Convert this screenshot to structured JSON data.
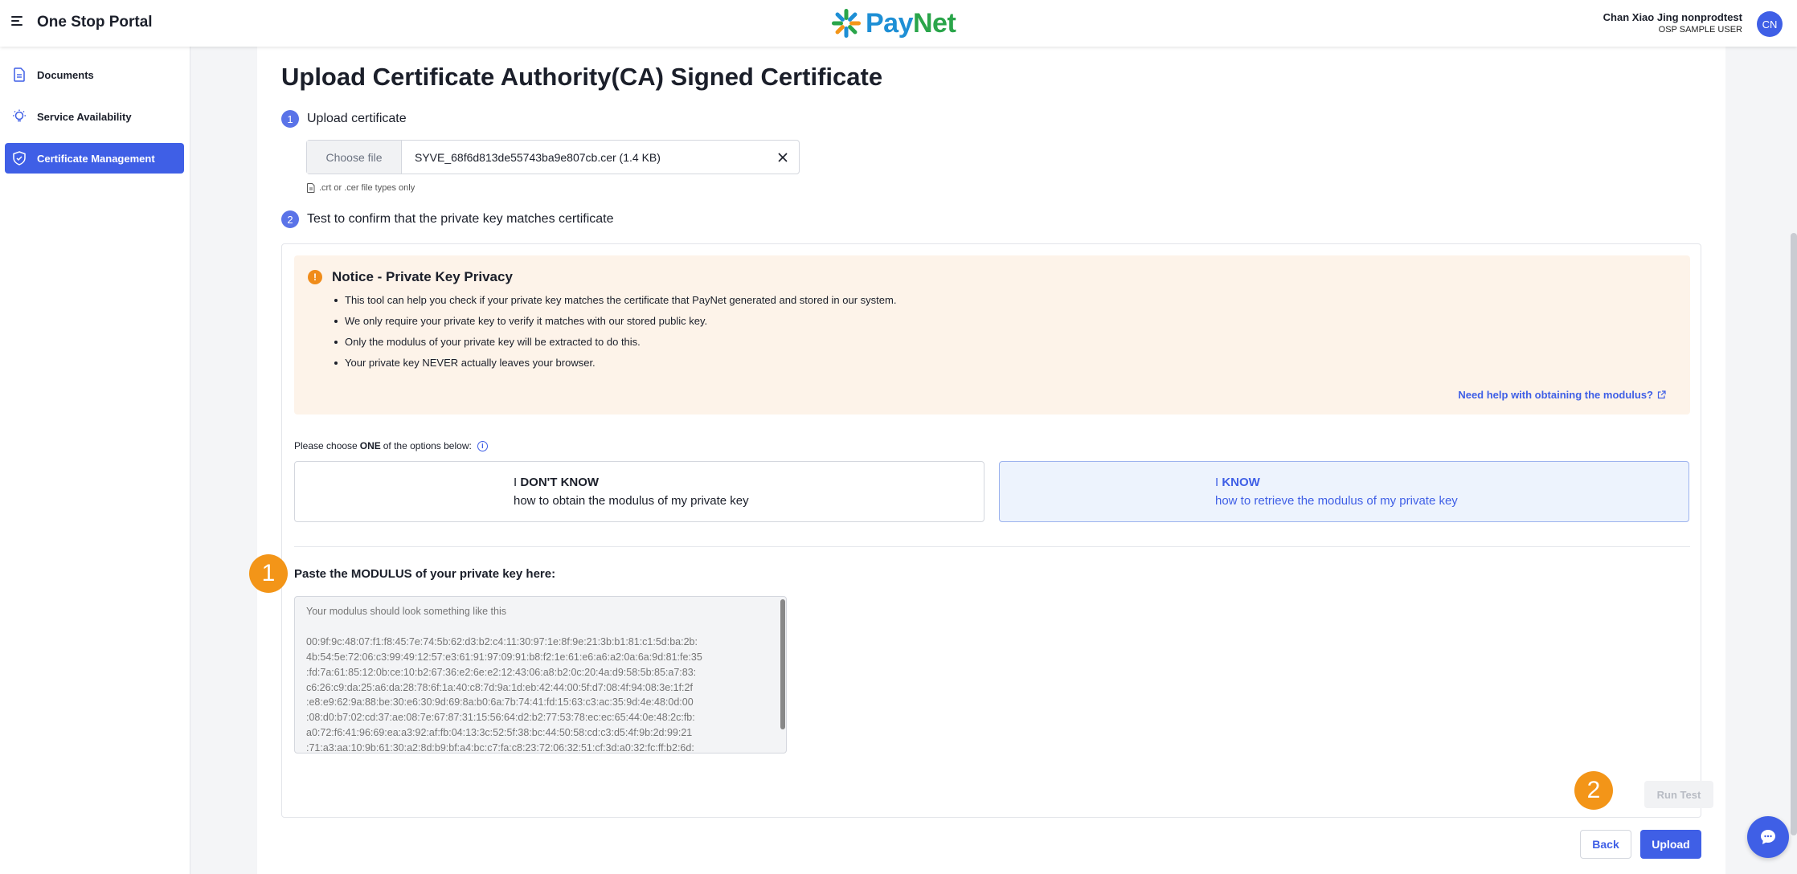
{
  "header": {
    "app_title": "One Stop Portal",
    "logo_text_pay": "Pay",
    "logo_text_net": "Net",
    "user_name": "Chan Xiao Jing nonprodtest",
    "user_role": "OSP SAMPLE USER",
    "avatar_initials": "CN"
  },
  "sidebar": {
    "items": [
      {
        "label": "Documents",
        "icon": "document-icon",
        "active": false
      },
      {
        "label": "Service Availability",
        "icon": "lightbulb-icon",
        "active": false
      },
      {
        "label": "Certificate Management",
        "icon": "shield-check-icon",
        "active": true
      }
    ]
  },
  "main": {
    "title": "Upload Certificate Authority(CA) Signed Certificate",
    "step1": {
      "number": "1",
      "label": "Upload certificate"
    },
    "file": {
      "choose_label": "Choose file",
      "file_name": "SYVE_68f6d813de55743ba9e807cb.cer (1.4 KB)",
      "hint": ".crt or .cer file types only"
    },
    "step2": {
      "number": "2",
      "label": "Test to confirm that the private key matches certificate"
    },
    "notice": {
      "title": "Notice - Private Key Privacy",
      "items": [
        "This tool can help you check if your private key matches the certificate that PayNet generated and stored in our system.",
        "We only require your private key to verify it matches with our stored public key.",
        "Only the modulus of your private key will be extracted to do this.",
        "Your private key NEVER actually leaves your browser."
      ],
      "help_link": "Need help with obtaining the modulus?"
    },
    "choose": {
      "prefix": "Please choose",
      "emphasis": "ONE",
      "suffix": "of the options below:"
    },
    "options": [
      {
        "prefix": "I",
        "bold": "DON'T KNOW",
        "subtitle": "how to obtain the modulus of my private key",
        "selected": false
      },
      {
        "prefix": "I",
        "bold": "KNOW",
        "subtitle": "how to retrieve the modulus of my private key",
        "selected": true
      }
    ],
    "modulus_label": "Paste the MODULUS of your private key here:",
    "modulus_placeholder": "Your modulus should look something like this\n\n00:9f:9c:48:07:f1:f8:45:7e:74:5b:62:d3:b2:c4:11:30:97:1e:8f:9e:21:3b:b1:81:c1:5d:ba:2b:\n4b:54:5e:72:06:c3:99:49:12:57:e3:61:91:97:09:91:b8:f2:1e:61:e6:a6:a2:0a:6a:9d:81:fe:35\n:fd:7a:61:85:12:0b:ce:10:b2:67:36:e2:6e:e2:12:43:06:a8:b2:0c:20:4a:d9:58:5b:85:a7:83:\nc6:26:c9:da:25:a6:da:28:78:6f:1a:40:c8:7d:9a:1d:eb:42:44:00:5f:d7:08:4f:94:08:3e:1f:2f\n:e8:e9:62:9a:88:be:30:e6:30:9d:69:8a:b0:6a:7b:74:41:fd:15:63:c3:ac:35:9d:4e:48:0d:00\n:08:d0:b7:02:cd:37:ae:08:7e:67:87:31:15:56:64:d2:b2:77:53:78:ec:ec:65:44:0e:48:2c:fb:\na0:72:f6:41:96:69:ea:a3:92:af:fb:04:13:3c:52:5f:38:bc:44:50:58:cd:c3:d5:4f:9b:2d:99:21\n:71:a3:aa:10:9b:61:30:a2:8d:b9:bf:a4:bc:c7:fa:c8:23:72:06:32:51:cf:3d:a0:32:fc:ff:b2:6d:",
    "run_test_label": "Run Test",
    "callouts": [
      "1",
      "2"
    ],
    "back_label": "Back",
    "upload_label": "Upload"
  },
  "colors": {
    "accent": "#3f5fe6",
    "notice_bg": "#fdf3e9",
    "callout": "#f39518",
    "paynet_blue": "#1e8fd5",
    "paynet_green": "#2aa54a"
  }
}
